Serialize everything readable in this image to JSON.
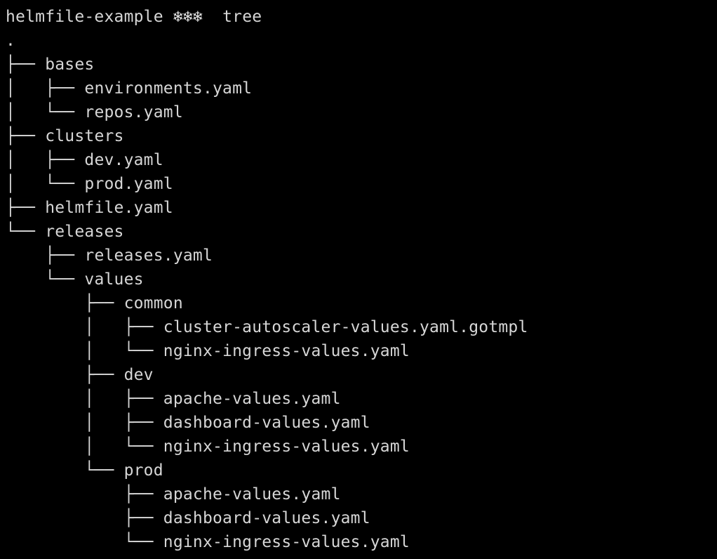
{
  "prompt": {
    "directory": "helmfile-example",
    "icons": "❄❄❄",
    "command": "tree"
  },
  "tree": [
    {
      "prefix": "",
      "name": "."
    },
    {
      "prefix": "├── ",
      "name": "bases"
    },
    {
      "prefix": "│   ├── ",
      "name": "environments.yaml"
    },
    {
      "prefix": "│   └── ",
      "name": "repos.yaml"
    },
    {
      "prefix": "├── ",
      "name": "clusters"
    },
    {
      "prefix": "│   ├── ",
      "name": "dev.yaml"
    },
    {
      "prefix": "│   └── ",
      "name": "prod.yaml"
    },
    {
      "prefix": "├── ",
      "name": "helmfile.yaml"
    },
    {
      "prefix": "└── ",
      "name": "releases"
    },
    {
      "prefix": "    ├── ",
      "name": "releases.yaml"
    },
    {
      "prefix": "    └── ",
      "name": "values"
    },
    {
      "prefix": "        ├── ",
      "name": "common"
    },
    {
      "prefix": "        │   ├── ",
      "name": "cluster-autoscaler-values.yaml.gotmpl"
    },
    {
      "prefix": "        │   └── ",
      "name": "nginx-ingress-values.yaml"
    },
    {
      "prefix": "        ├── ",
      "name": "dev"
    },
    {
      "prefix": "        │   ├── ",
      "name": "apache-values.yaml"
    },
    {
      "prefix": "        │   ├── ",
      "name": "dashboard-values.yaml"
    },
    {
      "prefix": "        │   └── ",
      "name": "nginx-ingress-values.yaml"
    },
    {
      "prefix": "        └── ",
      "name": "prod"
    },
    {
      "prefix": "            ├── ",
      "name": "apache-values.yaml"
    },
    {
      "prefix": "            ├── ",
      "name": "dashboard-values.yaml"
    },
    {
      "prefix": "            └── ",
      "name": "nginx-ingress-values.yaml"
    }
  ]
}
